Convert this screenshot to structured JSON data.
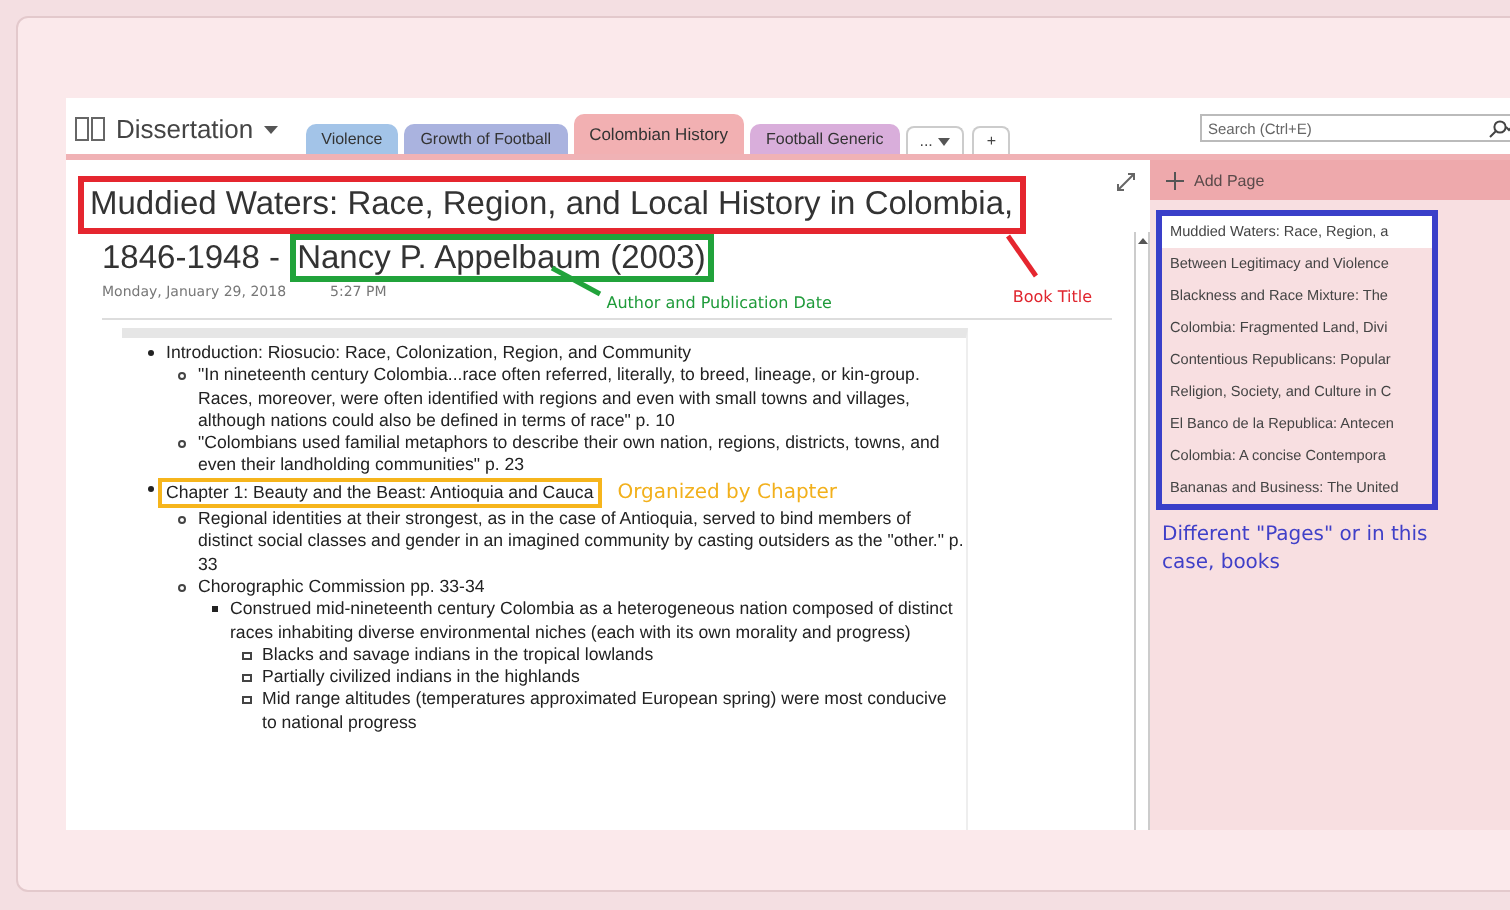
{
  "notebook": {
    "name": "Dissertation"
  },
  "tabs": [
    {
      "label": "Violence",
      "color": "#a3c4e8",
      "selected": false
    },
    {
      "label": "Growth of Football",
      "color": "#aab3df",
      "selected": false
    },
    {
      "label": "Colombian History",
      "color": "#f2b0b2",
      "selected": true
    },
    {
      "label": "Football Generic",
      "color": "#d9aedb",
      "selected": false
    }
  ],
  "more_tab": {
    "label": "..."
  },
  "add_tab": {
    "label": "+"
  },
  "search": {
    "placeholder": "Search (Ctrl+E)"
  },
  "page": {
    "title_line_1": "Muddied Waters: Race, Region, and Local History in Colombia,",
    "title_line_2": "1846-1948 - ",
    "author": "Nancy P. Appelbaum (2003)",
    "date": "Monday, January 29, 2018",
    "time": "5:27 PM"
  },
  "annotations": {
    "title": "Book Title",
    "author": "Author and Publication Date",
    "chapter": "Organized by Chapter",
    "pages": "Different \"Pages\" or in this case, books"
  },
  "outline": [
    {
      "text": "Introduction: Riosucio: Race, Colonization, Region, and Community",
      "highlighted": false,
      "children": [
        {
          "text": "\"In nineteenth century Colombia...race often referred, literally, to breed, lineage, or kin-group. Races, moreover, were often identified with regions and even with small towns and villages, although nations could also be defined in terms of race\" p. 10"
        },
        {
          "text": "\"Colombians used familial metaphors to describe their own nation, regions, districts, towns, and even their landholding communities\" p. 23"
        }
      ]
    },
    {
      "text": "Chapter 1: Beauty and the Beast: Antioquia and Cauca",
      "highlighted": true,
      "children": [
        {
          "text": "Regional identities at their strongest, as in the case of Antioquia, served to bind members of distinct social classes and gender in an imagined community by casting outsiders as the \"other.\" p. 33"
        },
        {
          "text": "Chorographic Commission pp. 33-34",
          "children": [
            {
              "text": "Construed mid-nineteenth century Colombia as a heterogeneous nation composed of distinct races inhabiting diverse environmental niches (each with its own morality and progress)",
              "children": [
                {
                  "text": "Blacks and savage indians in the tropical lowlands"
                },
                {
                  "text": "Partially civilized indians in the highlands"
                },
                {
                  "text": "Mid range altitudes (temperatures approximated European spring) were most conducive to national progress"
                }
              ]
            }
          ]
        }
      ]
    }
  ],
  "add_page": {
    "label": "Add Page"
  },
  "pages": [
    {
      "title": "Muddied Waters: Race, Region, a",
      "selected": true
    },
    {
      "title": "Between Legitimacy and Violence",
      "selected": false
    },
    {
      "title": "Blackness and Race Mixture: The",
      "selected": false
    },
    {
      "title": "Colombia: Fragmented Land, Divi",
      "selected": false
    },
    {
      "title": "Contentious Republicans: Popular",
      "selected": false
    },
    {
      "title": "Religion, Society, and Culture in C",
      "selected": false
    },
    {
      "title": "El Banco de la Republica: Antecen",
      "selected": false
    },
    {
      "title": "Colombia: A concise Contempora",
      "selected": false
    },
    {
      "title": "Bananas and Business: The United",
      "selected": false
    }
  ]
}
